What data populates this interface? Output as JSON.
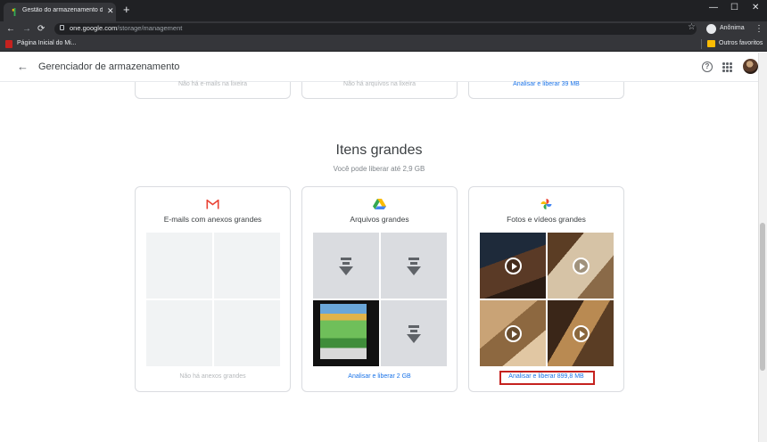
{
  "browser": {
    "tab_title": "Gestão do armazenamento do G",
    "tab_close": "✕",
    "new_tab": "+",
    "window_controls": [
      "—",
      "☐",
      "✕"
    ],
    "nav": {
      "back": "←",
      "forward": "→",
      "reload": "⟳"
    },
    "url_host": "one.google.com",
    "url_path": "/storage/management",
    "star": "☆",
    "profile_label": "Anônima",
    "menu": "⋮",
    "bookmarks": [
      {
        "label": "Página Inicial do Mi..."
      }
    ],
    "other_bookmarks": "Outros favoritos"
  },
  "app": {
    "back_icon": "←",
    "title": "Gerenciador de armazenamento",
    "help_icon": "?"
  },
  "top_cards": [
    {
      "text": "Não há e-mails na lixeira"
    },
    {
      "text": "Não há arquivos na lixeira"
    },
    {
      "text": "Analisar e liberar 39 MB"
    }
  ],
  "section": {
    "title": "Itens grandes",
    "subtitle": "Você pode liberar até 2,9 GB"
  },
  "cards": [
    {
      "title": "E-mails com anexos grandes",
      "footer": "Não há anexos grandes",
      "icon": "gmail-icon"
    },
    {
      "title": "Arquivos grandes",
      "footer": "Analisar e liberar 2 GB",
      "icon": "drive-icon"
    },
    {
      "title": "Fotos e vídeos grandes",
      "footer": "Analisar e liberar 899,8 MB",
      "icon": "photos-icon"
    }
  ],
  "colors": {
    "chrome_dark": "#202124",
    "chrome_toolbar": "#35363a",
    "link_blue": "#1a73e8",
    "highlight_red": "#c5221f",
    "placeholder_gray": "#f1f3f4",
    "file_gray": "#dadce0"
  }
}
